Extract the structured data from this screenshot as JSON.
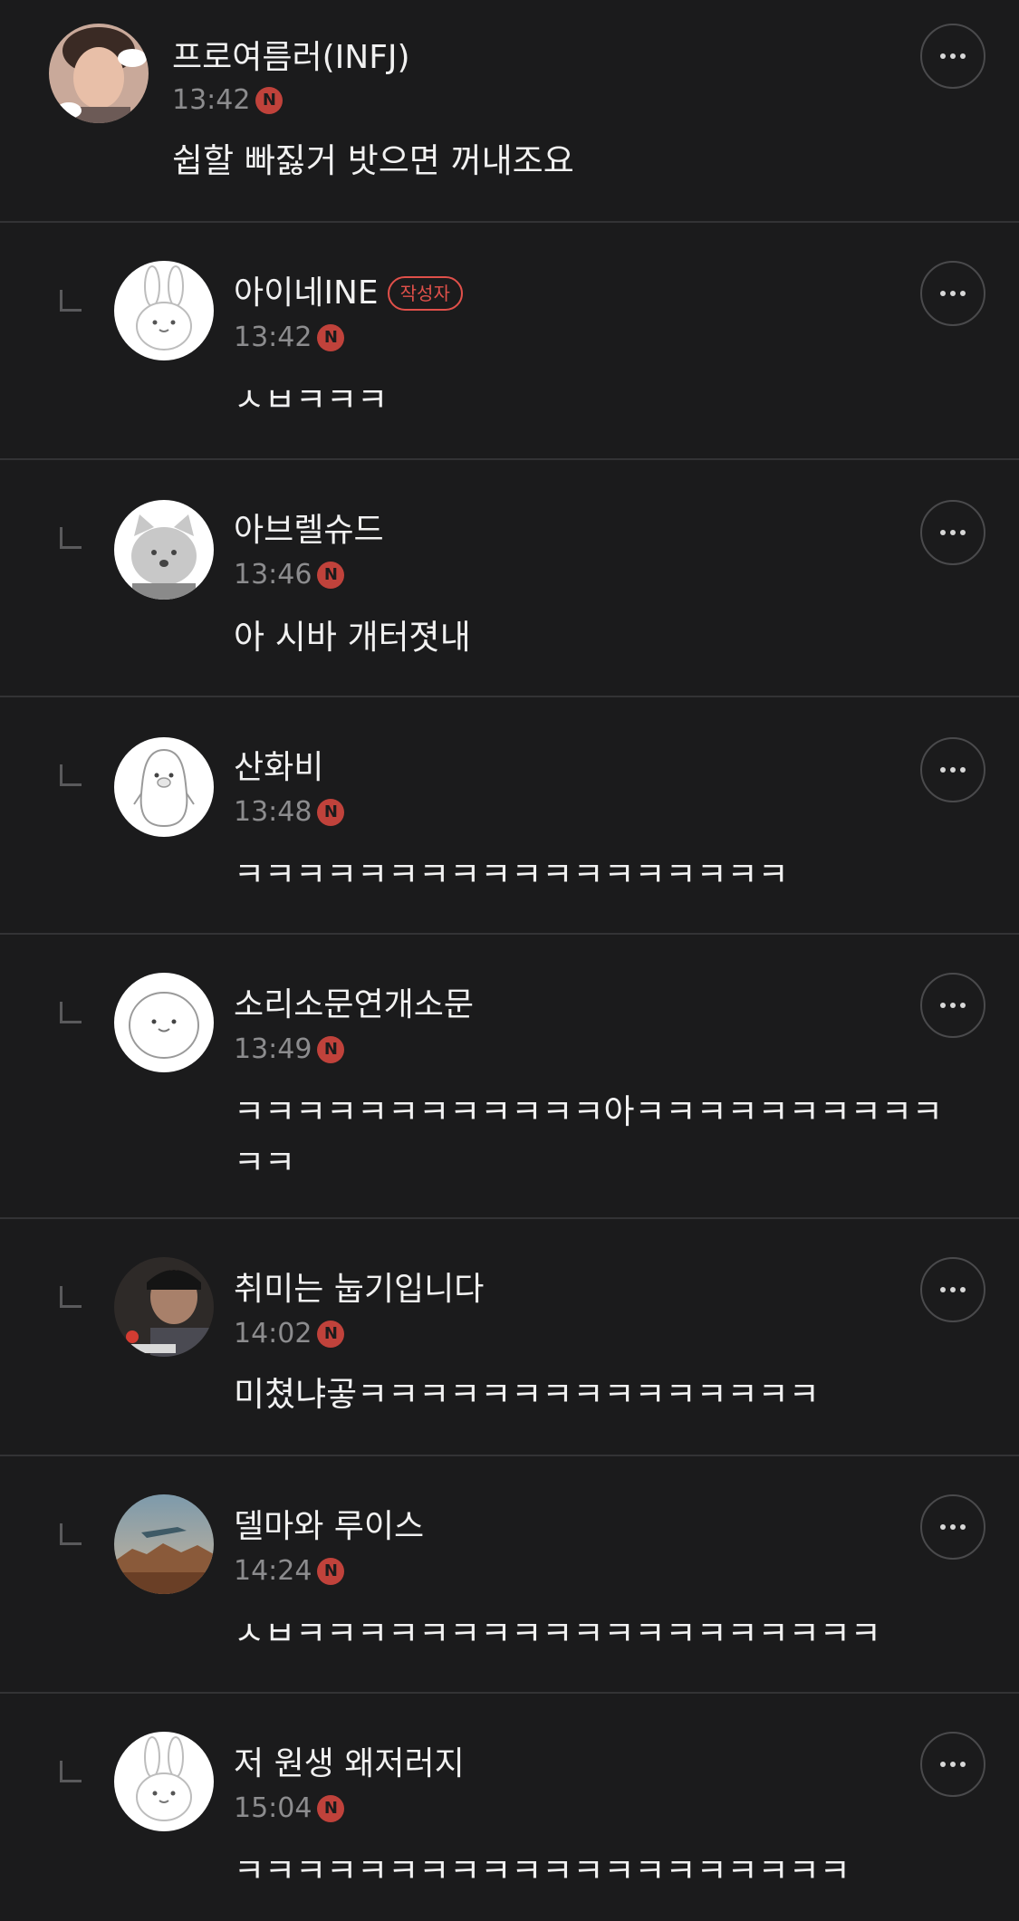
{
  "comments": [
    {
      "author": "프로여름러(INFJ)",
      "time": "13:42",
      "new_badge": "N",
      "text": "쉽할 빠짏거 밧으면 꺼내조요",
      "is_reply": false,
      "is_writer": false,
      "avatar_icon": "photo-boy-icon"
    },
    {
      "author": "아이네INE",
      "writer_badge": "작성자",
      "time": "13:42",
      "new_badge": "N",
      "text": "ㅅㅂㅋㅋㅋ",
      "is_reply": true,
      "is_writer": true,
      "avatar_icon": "rabbit-icon"
    },
    {
      "author": "아브렐슈드",
      "time": "13:46",
      "new_badge": "N",
      "text": "아 시바 개터졋내",
      "is_reply": true,
      "is_writer": false,
      "avatar_icon": "cat-icon"
    },
    {
      "author": "산화비",
      "time": "13:48",
      "new_badge": "N",
      "text": "ㅋㅋㅋㅋㅋㅋㅋㅋㅋㅋㅋㅋㅋㅋㅋㅋㅋㅋ",
      "is_reply": true,
      "is_writer": false,
      "avatar_icon": "penguin-icon"
    },
    {
      "author": "소리소문연개소문",
      "time": "13:49",
      "new_badge": "N",
      "text": "ㅋㅋㅋㅋㅋㅋㅋㅋㅋㅋㅋㅋ아ㅋㅋㅋㅋㅋㅋㅋㅋㅋㅋㅋㅋ",
      "is_reply": true,
      "is_writer": false,
      "avatar_icon": "seal-icon"
    },
    {
      "author": "취미는 눕기입니다",
      "time": "14:02",
      "new_badge": "N",
      "text": "미쳤냐곻ㅋㅋㅋㅋㅋㅋㅋㅋㅋㅋㅋㅋㅋㅋㅋ",
      "is_reply": true,
      "is_writer": false,
      "avatar_icon": "photo-man-icon"
    },
    {
      "author": "델마와 루이스",
      "time": "14:24",
      "new_badge": "N",
      "text": "ㅅㅂㅋㅋㅋㅋㅋㅋㅋㅋㅋㅋㅋㅋㅋㅋㅋㅋㅋㅋㅋ",
      "is_reply": true,
      "is_writer": false,
      "avatar_icon": "photo-car-icon"
    },
    {
      "author": "저 원생 왜저러지",
      "time": "15:04",
      "new_badge": "N",
      "text": "ㅋㅋㅋㅋㅋㅋㅋㅋㅋㅋㅋㅋㅋㅋㅋㅋㅋㅋㅋㅋ",
      "is_reply": true,
      "is_writer": false,
      "avatar_icon": "rabbit-icon"
    }
  ],
  "colors": {
    "background": "#1b1b1c",
    "divider": "#333335",
    "meta_text": "#8c8c8e",
    "new_badge": "#c0423b",
    "writer_badge": "#e0504a"
  }
}
